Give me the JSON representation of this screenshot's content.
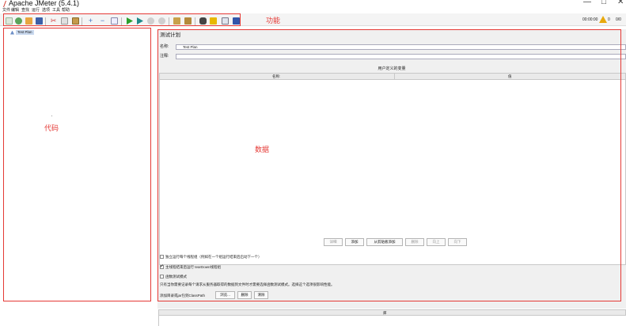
{
  "window": {
    "title": "Apache JMeter (5.4.1)",
    "minimize": "—",
    "maximize": "□",
    "close": "✕"
  },
  "menu": [
    "文件",
    "编辑",
    "查找",
    "运行",
    "选项",
    "工具",
    "帮助"
  ],
  "toolbar": {
    "timer": "00:00:00",
    "warnings": "0",
    "threads": "0/0"
  },
  "annotations": {
    "toolbar_label": "功能",
    "code_label": "代码",
    "data_label": "数据"
  },
  "tree": {
    "root_label": "Test Plan"
  },
  "plan": {
    "title": "测试计划",
    "name_label": "名称:",
    "name_value": "Test Plan",
    "comment_label": "注释:",
    "comment_value": "",
    "vars_title": "用户定义的变量",
    "col_name": "名称:",
    "col_value": "值",
    "buttons": [
      "详细",
      "添加",
      "从剪贴板添加",
      "删除",
      "向上",
      "向下"
    ],
    "checkbox_1": "独立运行每个线程组（例如在一个组运行结束后启动下一个）",
    "checkbox_1_checked": false,
    "checkbox_2": "主线程结束后运行 tearDown线程组",
    "checkbox_2_checked": true,
    "checkbox_3": "函数测试模式",
    "checkbox_3_checked": false,
    "note": "只有当你需要记录每个请求从服务器取得的数据到文件时才需要选择函数测试模式。选择这个选项很影响性能。",
    "classpath_label": "添加目录或jar包到ClassPath",
    "classpath_buttons": [
      "浏览...",
      "删除",
      "清除"
    ],
    "classpath_col": "库"
  }
}
